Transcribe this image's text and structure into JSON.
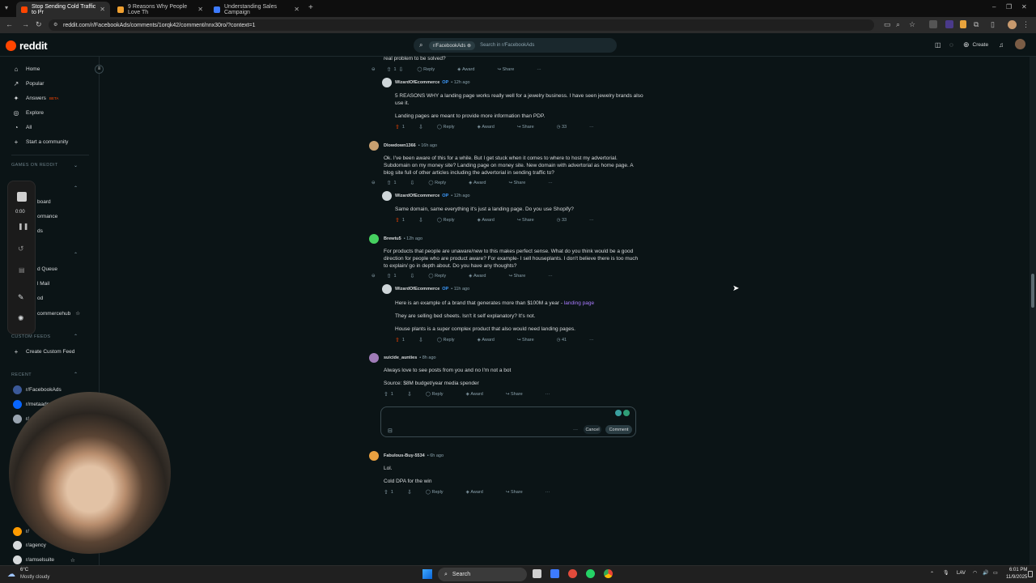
{
  "browser": {
    "tabs": [
      {
        "title": "Stop Sending Cold Traffic to Pr",
        "color": "#ff4500",
        "active": true
      },
      {
        "title": "9 Reasons Why People Love Th",
        "color": "#f0a030",
        "active": false
      },
      {
        "title": "Understanding Sales Campaign",
        "color": "#3d7bff",
        "active": false
      }
    ],
    "url": "reddit.com/r/FacebookAds/comments/1orqk42/comment/nnx30ro/?context=1"
  },
  "header": {
    "logo": "reddit",
    "search_chip": "r/FacebookAds",
    "search_placeholder": "Search in r/FacebookAds",
    "create_label": "Create"
  },
  "sidebar": {
    "nav": [
      {
        "label": "Home",
        "icon": "home-icon"
      },
      {
        "label": "Popular",
        "icon": "popular-icon"
      },
      {
        "label": "Answers",
        "icon": "answers-icon",
        "badge": "BETA"
      },
      {
        "label": "Explore",
        "icon": "explore-icon"
      },
      {
        "label": "All",
        "icon": "all-icon"
      },
      {
        "label": "Start a community",
        "icon": "plus-icon"
      }
    ],
    "games_heading": "GAMES ON REDDIT",
    "partial_items": [
      "board",
      "ormance",
      "ds",
      "d Queue",
      "l Mail",
      "od",
      "commercehub"
    ],
    "custom_feeds_heading": "CUSTOM FEEDS",
    "create_custom_feed": "Create Custom Feed",
    "recent_heading": "RECENT",
    "recent": [
      {
        "label": "r/FacebookAds",
        "color": "#3b5998"
      },
      {
        "label": "r/metaads",
        "color": "#0866ff"
      },
      {
        "label": "r/",
        "color": "#9aa5b1"
      },
      {
        "label": "r/",
        "color": "#e0e0e0"
      },
      {
        "label": "r/",
        "color": "#ff9b00"
      },
      {
        "label": "r/agency",
        "color": "#d7dadc"
      },
      {
        "label": "r/amselsuite",
        "color": "#d7dadc"
      }
    ]
  },
  "recorder": {
    "time": "0:00"
  },
  "comments": {
    "top_fragment": "real problem to be solved?",
    "c1": {
      "author": "WizardOfEcommerce",
      "op": "OP",
      "time": "12h ago",
      "lines": [
        "5 REASONS WHY a landing page works really well for a jewelry business. I have seen jewelry brands also",
        "use it.",
        "Landing pages are meant to provide more information than PDP."
      ],
      "votes": "1",
      "awards": "33"
    },
    "c2": {
      "author": "Dlowdown1366",
      "time": "16h ago",
      "lines": [
        "Ok. I've been aware of this for a while. But I get stuck when it comes to where to host my advertorial.",
        "Subdomain on my money site? Landing page on money site. New domain with advertorial as home page. A",
        "blog site full of other articles including the advertorial in sending traffic to?"
      ],
      "votes": "1"
    },
    "c3": {
      "author": "WizardOfEcommerce",
      "op": "OP",
      "time": "12h ago",
      "lines": [
        "Same domain, same everything it's just a landing page. Do you use Shopify?"
      ],
      "votes": "1",
      "awards": "33"
    },
    "c4": {
      "author": "Brewtu5",
      "time": "12h ago",
      "lines": [
        "For products that people are unaware/new to this makes perfect sense. What do you think would be a good",
        "direction for people who are product aware? For example- I sell houseplants. I don't believe there is too much",
        "to explain/ go in depth about. Do you have any thoughts?"
      ],
      "votes": "1"
    },
    "c5": {
      "author": "WizardOfEcommerce",
      "op": "OP",
      "time": "11h ago",
      "line1": "Here is an example of a brand that generates more than $100M a year - ",
      "link": "landing page",
      "line2": "They are selling bed sheets. Isn't it self explanatory? It's not.",
      "line3": "House plants is a super complex product that also would need landing pages.",
      "votes": "1",
      "awards": "41"
    },
    "c6": {
      "author": "suicide_aunties",
      "time": "8h ago",
      "lines": [
        "Always love to see posts from you and no I'm not a bot",
        "Source: $8M budget/year media spender"
      ],
      "votes": "1"
    },
    "c7": {
      "author": "Fabulous-Buy-5534",
      "time": "6h ago",
      "lines": [
        "Lol.",
        "Cold DPA for the win"
      ],
      "votes": "1"
    },
    "actions": {
      "reply": "Reply",
      "award": "Award",
      "share": "Share"
    },
    "reply_box": {
      "cancel": "Cancel",
      "submit": "Comment"
    }
  },
  "taskbar": {
    "weather_temp": "6°C",
    "weather_desc": "Mostly cloudy",
    "search": "Search",
    "lang": "LAV",
    "time": "6:01 PM",
    "date": "11/9/2025"
  }
}
